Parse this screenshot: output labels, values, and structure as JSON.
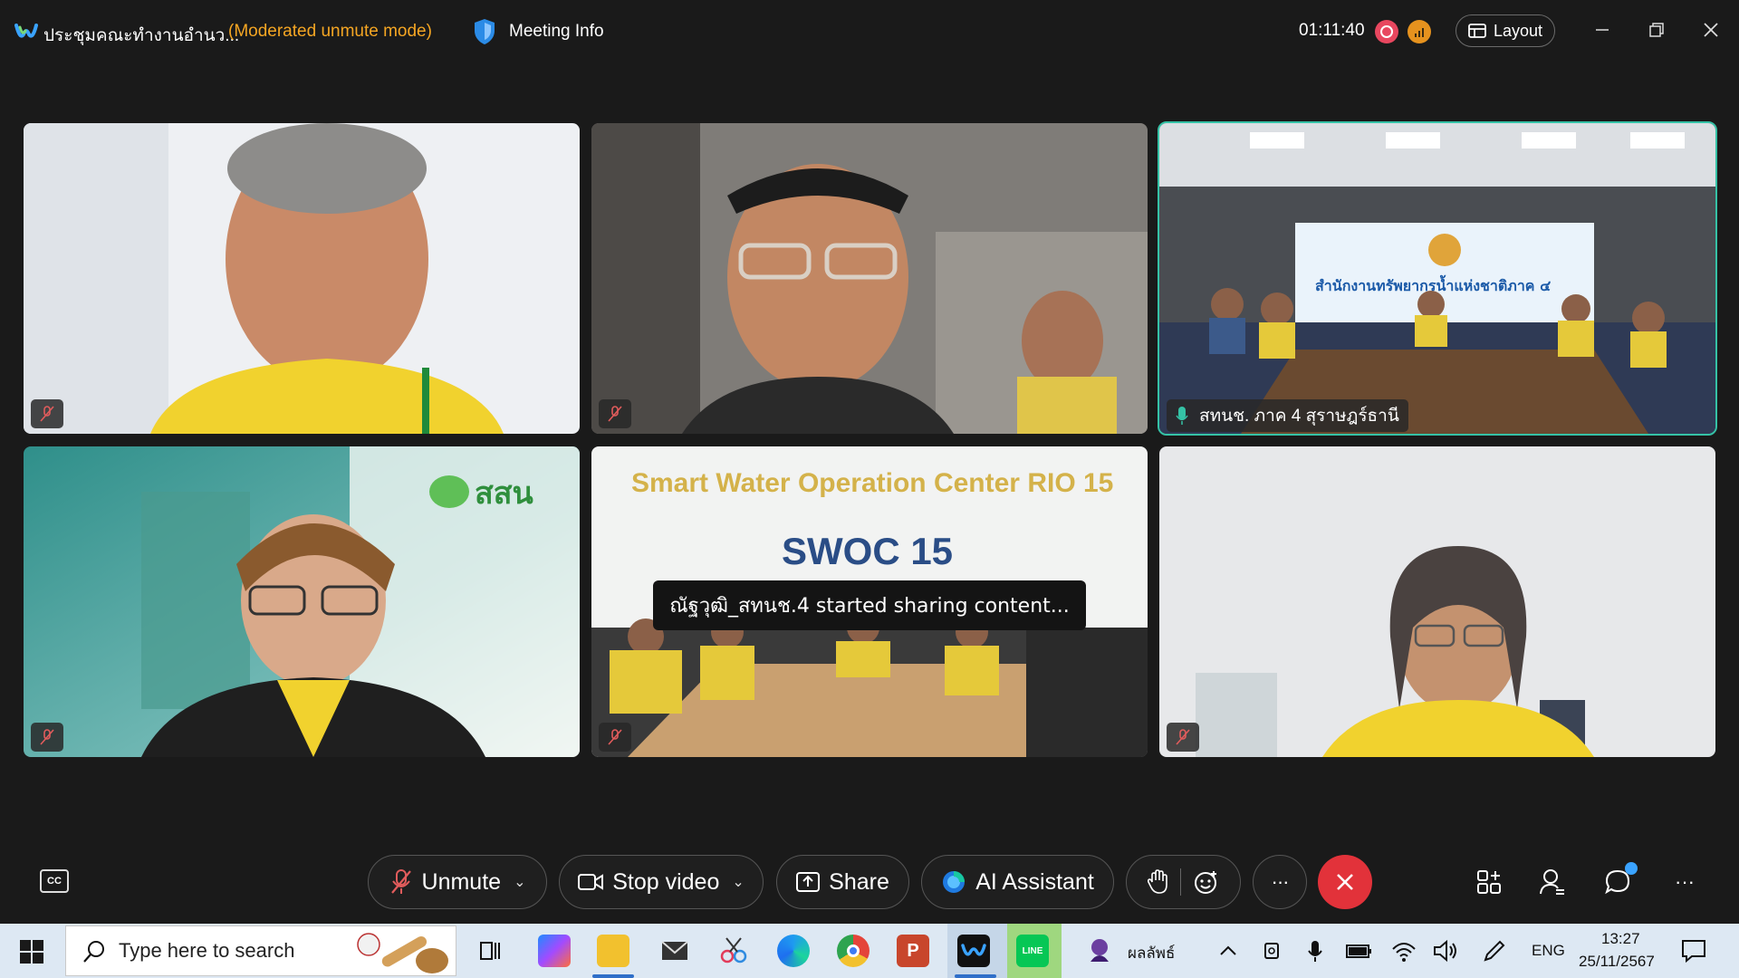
{
  "titlebar": {
    "meeting_title": "ประชุมคณะทำงานอำนว...",
    "mode": "(Moderated unmute mode)",
    "meeting_info": "Meeting Info",
    "timer": "01:11:40",
    "layout_label": "Layout"
  },
  "tiles": [
    {
      "id": "p1",
      "name": "",
      "muted": true
    },
    {
      "id": "p2",
      "name": "",
      "muted": true
    },
    {
      "id": "p3",
      "name": "สทนช. ภาค 4 สุราษฎร์ธานี",
      "active": true
    },
    {
      "id": "p4",
      "name": "",
      "muted": true,
      "logo_text": "สสน"
    },
    {
      "id": "p5",
      "name": "",
      "muted": true,
      "banner_line1": "Smart Water Operation Center RIO 15",
      "banner_line2": "SWOC 15"
    },
    {
      "id": "p6",
      "name": "",
      "muted": true
    }
  ],
  "room_sign": "สำนักงานทรัพยากรน้ำแห่งชาติภาค ๔",
  "toast": "ณัฐวุฒิ_สทนช.4 started sharing content...",
  "controls": {
    "unmute": "Unmute",
    "stop_video": "Stop video",
    "share": "Share",
    "ai_assistant": "AI Assistant",
    "more": "···"
  },
  "taskbar": {
    "search_placeholder": "Type here to search",
    "weather_label": "ผลลัพธ์",
    "lang": "ENG",
    "time": "13:27",
    "date": "25/11/2567"
  },
  "colors": {
    "accent_active": "#35c2a6",
    "end_call": "#e2323a",
    "mode_text": "#f5a623",
    "recording": "#e8475f"
  }
}
